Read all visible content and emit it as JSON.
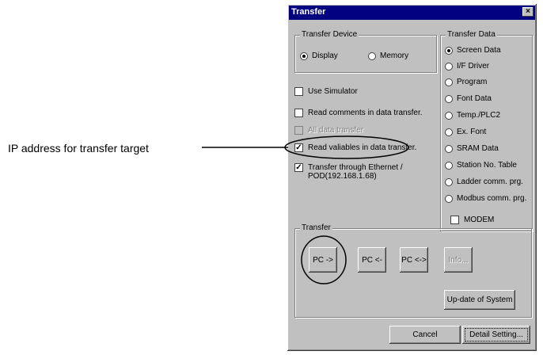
{
  "annotation": {
    "label": "IP address for transfer target"
  },
  "dialog": {
    "title": "Transfer",
    "close_glyph": "×",
    "transfer_device": {
      "legend": "Transfer Device",
      "options": [
        {
          "label": "Display",
          "selected": true
        },
        {
          "label": "Memory",
          "selected": false
        }
      ]
    },
    "checkboxes": [
      {
        "label": "Use Simulator",
        "checked": false,
        "enabled": true
      },
      {
        "label": "Read comments in data transfer.",
        "checked": false,
        "enabled": true
      },
      {
        "label": "All data transfer",
        "checked": false,
        "enabled": false
      },
      {
        "label": "Read valiables in data transfer.",
        "checked": true,
        "enabled": true
      },
      {
        "label_line1": "Transfer through Ethernet /",
        "label_line2": "POD(192.168.1.68)",
        "checked": true,
        "enabled": true
      }
    ],
    "check_mark": "✓",
    "transfer_data": {
      "legend": "Transfer Data",
      "options": [
        {
          "label": "Screen Data",
          "selected": true
        },
        {
          "label": "I/F Driver",
          "selected": false
        },
        {
          "label": "Program",
          "selected": false
        },
        {
          "label": "Font Data",
          "selected": false
        },
        {
          "label": "Temp./PLC2",
          "selected": false
        },
        {
          "label": "Ex. Font",
          "selected": false
        },
        {
          "label": "SRAM Data",
          "selected": false
        },
        {
          "label": "Station No. Table",
          "selected": false
        },
        {
          "label": "Ladder comm. prg.",
          "selected": false
        },
        {
          "label": "Modbus comm. prg.",
          "selected": false
        }
      ]
    },
    "modem": {
      "label": "MODEM",
      "checked": false
    },
    "transfer_group": {
      "legend": "Transfer",
      "buttons": {
        "pc_to": "PC ->",
        "pc_from": "PC <-",
        "pc_both": "PC <->",
        "info": "Info..."
      },
      "update_system": "Up-date of System"
    },
    "footer": {
      "cancel": "Cancel",
      "detail": "Detail Setting..."
    }
  }
}
